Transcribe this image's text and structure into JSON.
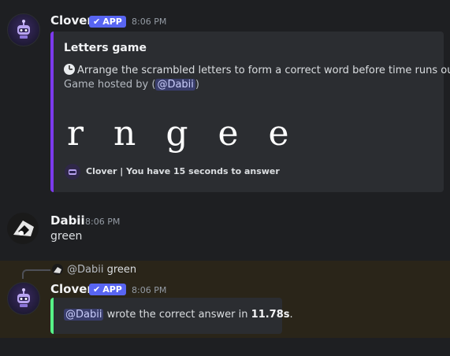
{
  "message1": {
    "author": "Clover",
    "badge": "APP",
    "time": "8:06 PM",
    "embed": {
      "title": "Letters game",
      "description": "Arrange the scrambled letters to form a correct word before time runs out.",
      "hosted_prefix": "Game hosted by (",
      "hosted_mention": "@Dabii",
      "hosted_suffix": ")",
      "scrambled": "r n g e e",
      "footer": "Clover | You have 15 seconds to answer",
      "accent_color": "#7c3aed"
    }
  },
  "message2": {
    "author": "Dabii",
    "time": "8:06 PM",
    "text": "green"
  },
  "message3": {
    "reply_mention": "@Dabii",
    "reply_text": "green",
    "author": "Clover",
    "badge": "APP",
    "time": "8:06 PM",
    "embed": {
      "mention": "@Dabii",
      "text_before": " wrote the correct answer in ",
      "time_value": "11.78s",
      "text_after": ".",
      "accent_color": "#57f287"
    }
  },
  "colors": {
    "background": "#1e1f22",
    "embed_bg": "#2b2d31",
    "badge": "#5865f2",
    "highlight": "#2a2519"
  }
}
